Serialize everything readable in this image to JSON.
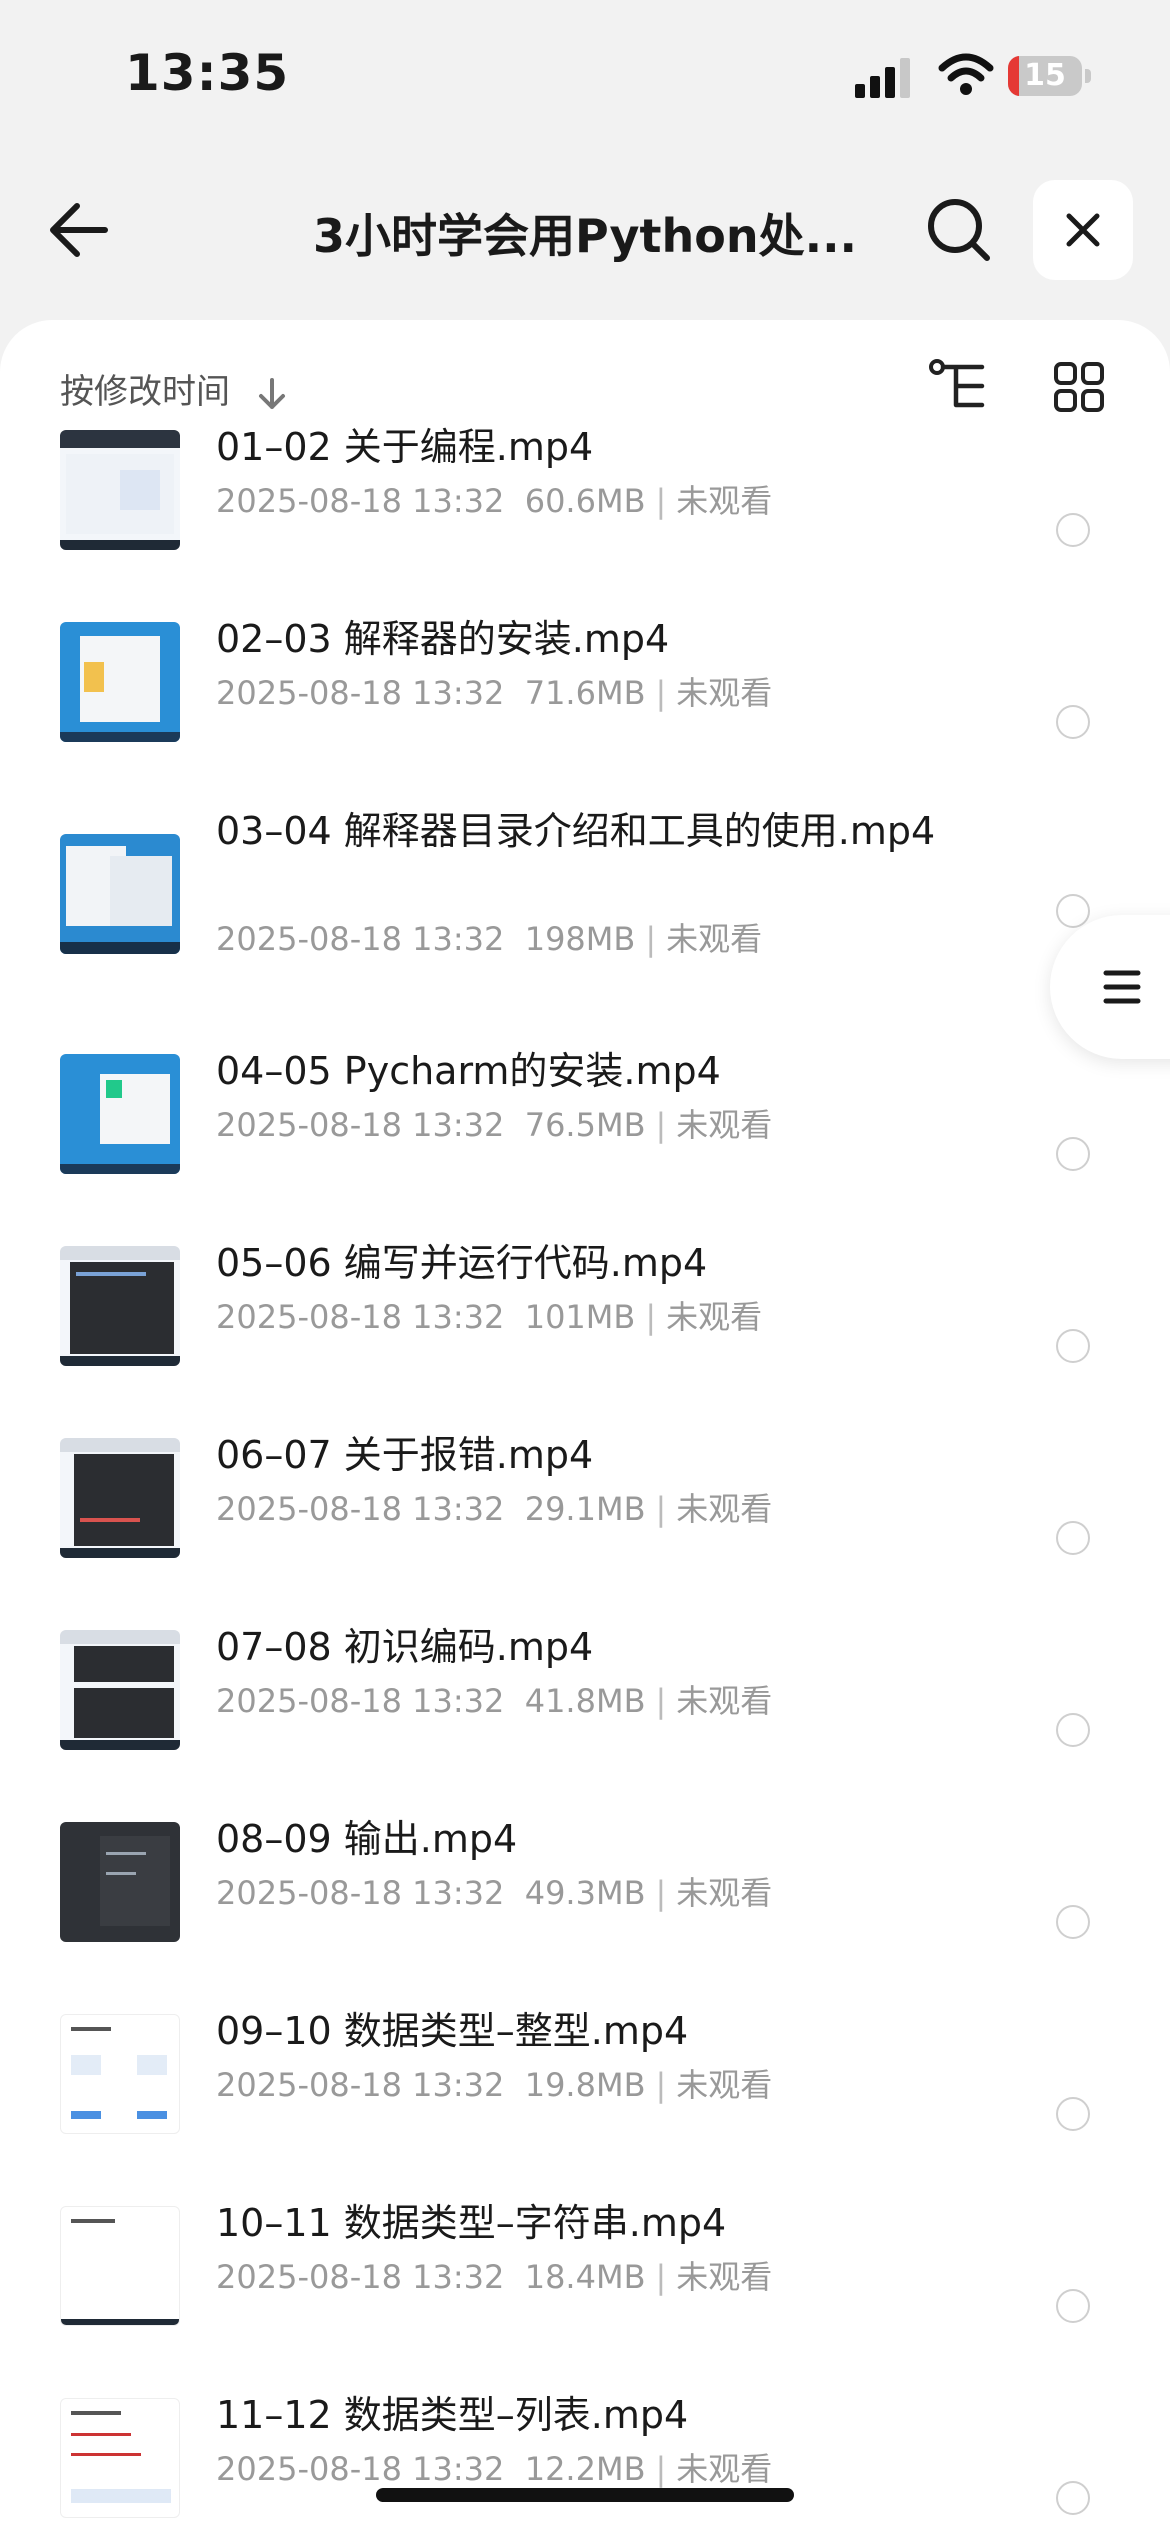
{
  "status_bar": {
    "time": "13:35",
    "battery_level": "15",
    "battery_fraction": 0.15,
    "battery_color": "#e53935"
  },
  "header": {
    "title": "3小时学会用Python处...",
    "back_icon": "arrow-left-icon",
    "search_icon": "search-icon",
    "close_icon": "close-icon"
  },
  "toolbar": {
    "sort_label": "按修改时间",
    "sort_icon": "arrow-down-icon",
    "tree_icon": "tree-view-icon",
    "grid_icon": "grid-view-icon"
  },
  "files": [
    {
      "name": "01–02 关于编程.mp4",
      "date": "2025-08-18 13:32",
      "size": "60.6MB",
      "status": "未观看"
    },
    {
      "name": "02–03 解释器的安装.mp4",
      "date": "2025-08-18 13:32",
      "size": "71.6MB",
      "status": "未观看"
    },
    {
      "name": "03–04 解释器目录介绍和工具的使用.mp4",
      "date": "2025-08-18 13:32",
      "size": "198MB",
      "status": "未观看"
    },
    {
      "name": "04–05 Pycharm的安装.mp4",
      "date": "2025-08-18 13:32",
      "size": "76.5MB",
      "status": "未观看"
    },
    {
      "name": "05–06 编写并运行代码.mp4",
      "date": "2025-08-18 13:32",
      "size": "101MB",
      "status": "未观看"
    },
    {
      "name": "06–07 关于报错.mp4",
      "date": "2025-08-18 13:32",
      "size": "29.1MB",
      "status": "未观看"
    },
    {
      "name": "07–08 初识编码.mp4",
      "date": "2025-08-18 13:32",
      "size": "41.8MB",
      "status": "未观看"
    },
    {
      "name": "08–09 输出.mp4",
      "date": "2025-08-18 13:32",
      "size": "49.3MB",
      "status": "未观看"
    },
    {
      "name": "09–10 数据类型–整型.mp4",
      "date": "2025-08-18 13:32",
      "size": "19.8MB",
      "status": "未观看"
    },
    {
      "name": "10–11 数据类型–字符串.mp4",
      "date": "2025-08-18 13:32",
      "size": "18.4MB",
      "status": "未观看"
    },
    {
      "name": "11–12 数据类型–列表.mp4",
      "date": "2025-08-18 13:32",
      "size": "12.2MB",
      "status": "未观看"
    }
  ],
  "float_menu": {
    "icon": "menu-lines-icon"
  }
}
